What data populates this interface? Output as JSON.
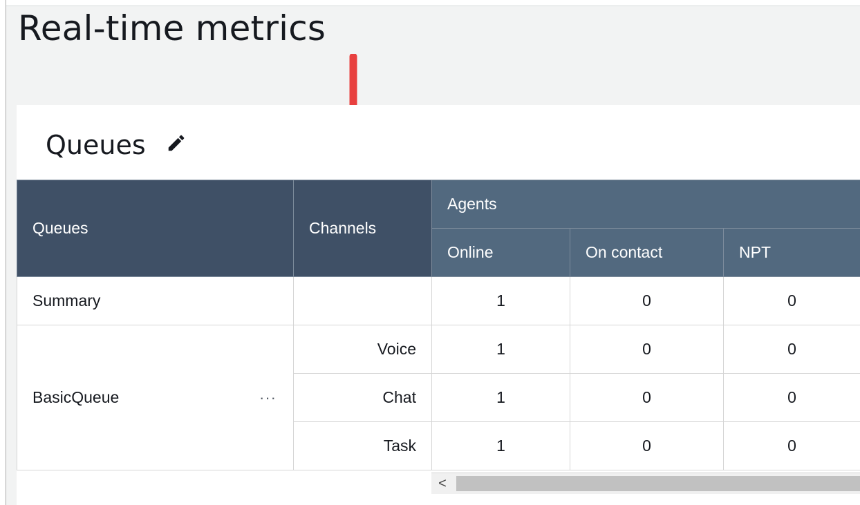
{
  "page": {
    "title": "Real-time metrics"
  },
  "card": {
    "title": "Queues",
    "edit_icon": "pencil-icon"
  },
  "table": {
    "headers": {
      "queues": "Queues",
      "channels": "Channels",
      "agents_group": "Agents",
      "online": "Online",
      "on_contact": "On contact",
      "npt": "NPT"
    },
    "summary": {
      "name": "Summary",
      "channel": "",
      "online": "1",
      "on_contact": "0",
      "npt": "0"
    },
    "queue": {
      "name": "BasicQueue",
      "more_icon": "ellipsis-icon",
      "more_label": "···",
      "rows": [
        {
          "channel": "Voice",
          "online": "1",
          "on_contact": "0",
          "npt": "0"
        },
        {
          "channel": "Chat",
          "online": "1",
          "on_contact": "0",
          "npt": "0"
        },
        {
          "channel": "Task",
          "online": "1",
          "on_contact": "0",
          "npt": "0"
        }
      ]
    }
  },
  "scrollbar": {
    "left_arrow": "<"
  },
  "colors": {
    "header_dark": "#3f5066",
    "header_light": "#52697f",
    "arrow": "#e8403f"
  }
}
